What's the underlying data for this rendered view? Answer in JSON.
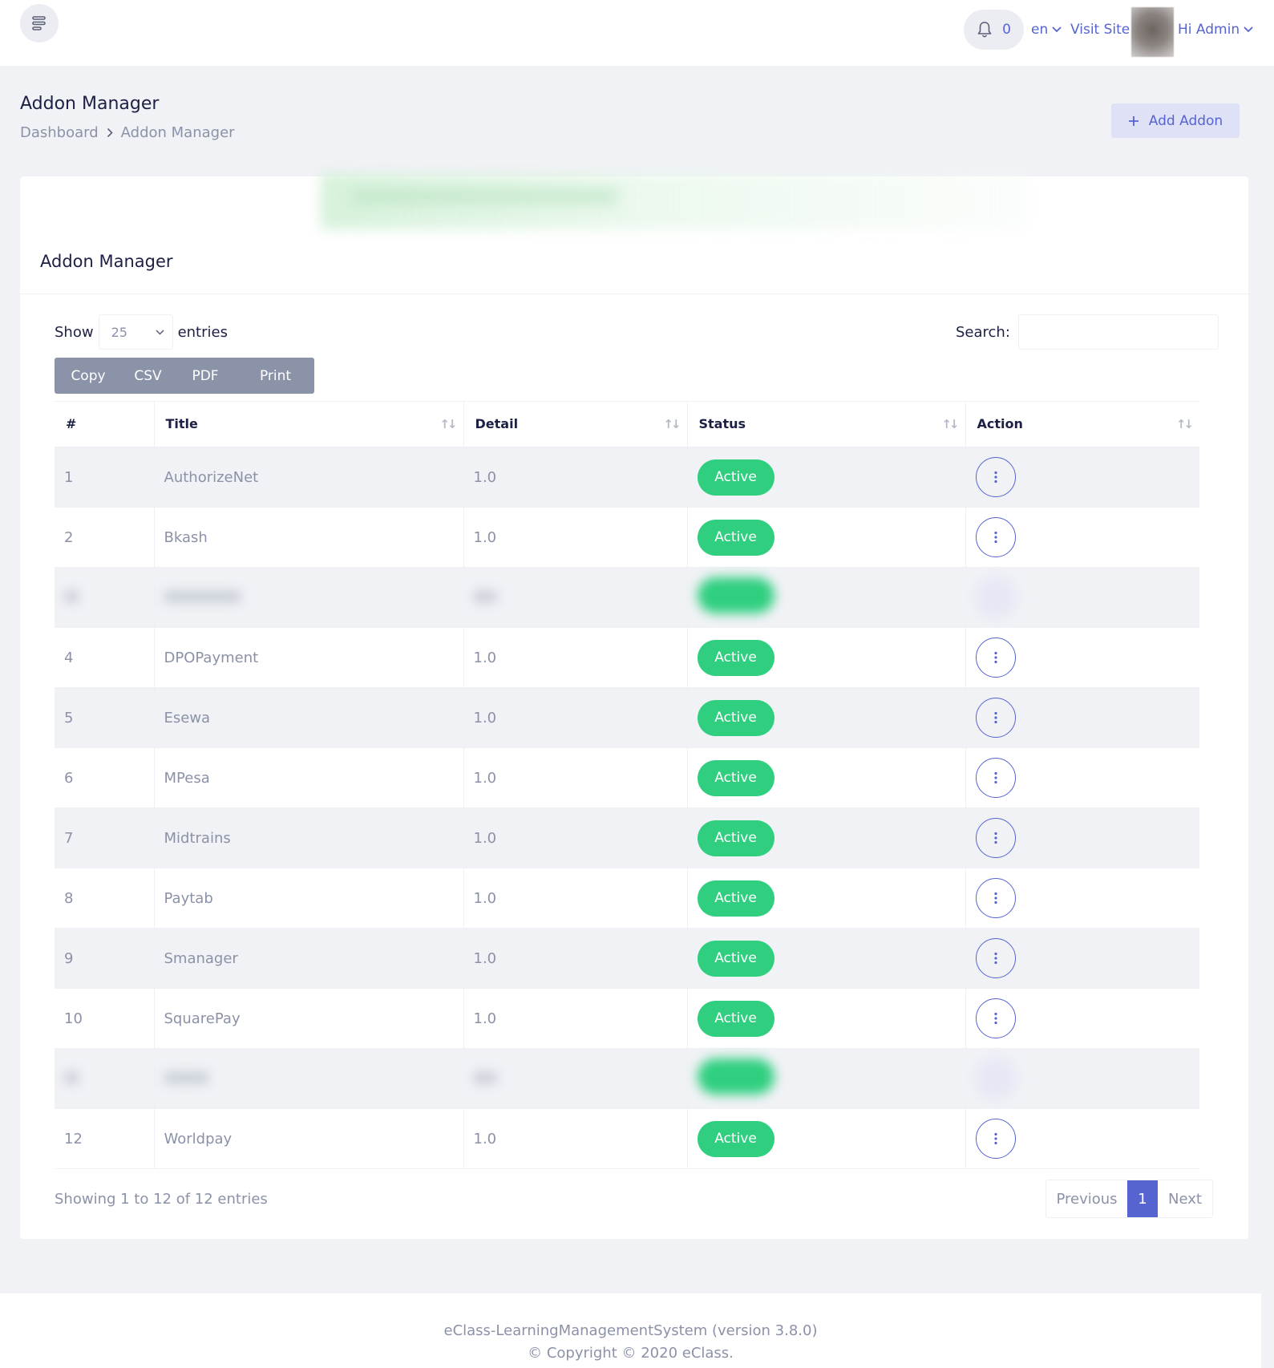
{
  "header": {
    "notification_count": "0",
    "language": "en",
    "visit_site": "Visit Site",
    "user_greeting": "Hi Admin"
  },
  "page": {
    "title": "Addon Manager",
    "breadcrumb": [
      "Dashboard",
      "Addon Manager"
    ],
    "add_button": "Add Addon"
  },
  "card": {
    "title": "Addon Manager",
    "show_label": "Show",
    "entries_label": "entries",
    "page_length": "25",
    "search_label": "Search:",
    "search_value": "",
    "export_buttons": [
      "Copy",
      "CSV",
      "PDF",
      "Print"
    ]
  },
  "table": {
    "columns": [
      "#",
      "Title",
      "Detail",
      "Status",
      "Action"
    ],
    "rows": [
      {
        "num": "1",
        "title": "AuthorizeNet",
        "detail": "1.0",
        "status": "Active",
        "blurred": false
      },
      {
        "num": "2",
        "title": "Bkash",
        "detail": "1.0",
        "status": "Active",
        "blurred": false
      },
      {
        "num": "",
        "title": "",
        "detail": "",
        "status": "",
        "blurred": true
      },
      {
        "num": "4",
        "title": "DPOPayment",
        "detail": "1.0",
        "status": "Active",
        "blurred": false
      },
      {
        "num": "5",
        "title": "Esewa",
        "detail": "1.0",
        "status": "Active",
        "blurred": false
      },
      {
        "num": "6",
        "title": "MPesa",
        "detail": "1.0",
        "status": "Active",
        "blurred": false
      },
      {
        "num": "7",
        "title": "Midtrains",
        "detail": "1.0",
        "status": "Active",
        "blurred": false
      },
      {
        "num": "8",
        "title": "Paytab",
        "detail": "1.0",
        "status": "Active",
        "blurred": false
      },
      {
        "num": "9",
        "title": "Smanager",
        "detail": "1.0",
        "status": "Active",
        "blurred": false
      },
      {
        "num": "10",
        "title": "SquarePay",
        "detail": "1.0",
        "status": "Active",
        "blurred": false
      },
      {
        "num": "",
        "title": "",
        "detail": "",
        "status": "",
        "blurred": true
      },
      {
        "num": "12",
        "title": "Worldpay",
        "detail": "1.0",
        "status": "Active",
        "blurred": false
      }
    ]
  },
  "pagination": {
    "info": "Showing 1 to 12 of 12 entries",
    "previous": "Previous",
    "current": "1",
    "next": "Next"
  },
  "footer": {
    "line1": "eClass-LearningManagementSystem (version 3.8.0)",
    "line2": "© Copyright © 2020 eClass."
  },
  "colors": {
    "accent": "#5664d2",
    "status_active": "#2fcf7f",
    "export_group": "#8a93a8"
  },
  "icons": {
    "menu": "menu-lines-icon",
    "notification": "bell-icon",
    "dropdown": "chevron-down-icon",
    "breadcrumb_separator": "chevron-right-icon",
    "add": "plus-icon",
    "sort": "sort-arrows-icon",
    "row_action": "vertical-ellipsis-icon"
  }
}
